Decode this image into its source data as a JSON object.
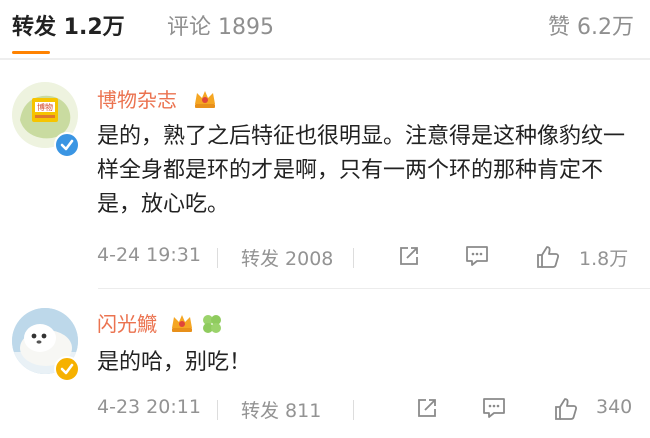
{
  "tabs": {
    "repost": "转发 1.2万",
    "comment": "评论 1895",
    "like": "赞 6.2万"
  },
  "colors": {
    "accent": "#ff8200",
    "username": "#eb7350",
    "muted": "#939393"
  },
  "comments": [
    {
      "avatar_text": "博物",
      "username": "博物杂志",
      "text": "是的，熟了之后特征也很明显。注意得是这种像豹纹一样全身都是环的才是啊，只有一两个环的那种肯定不是，放心吃。",
      "time": "4-24 19:31",
      "repost": "转发 2008",
      "likes": "1.8万",
      "icons": [
        "crown-icon",
        "verified-blue-icon",
        "share-icon",
        "comment-icon",
        "like-icon"
      ]
    },
    {
      "username": "闪光鱵",
      "text": "是的哈，别吃！",
      "time": "4-23 20:11",
      "repost": "转发 811",
      "likes": "340",
      "icons": [
        "crown-icon",
        "clover-icon",
        "verified-yellow-icon",
        "share-icon",
        "comment-icon",
        "like-icon"
      ]
    }
  ]
}
